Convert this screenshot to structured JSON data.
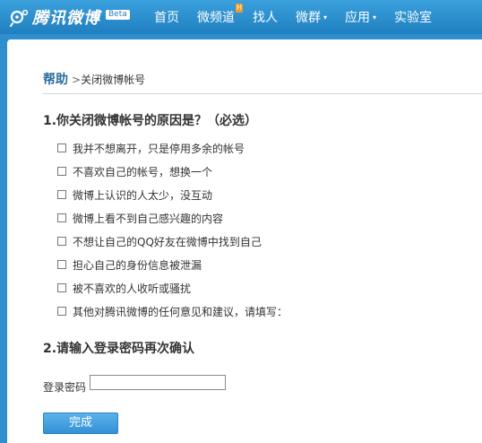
{
  "header": {
    "brand": "腾讯微博",
    "beta_badge": "Beta",
    "nav": [
      {
        "label": "首页"
      },
      {
        "label": "微频道",
        "badge": "H"
      },
      {
        "label": "找人"
      },
      {
        "label": "微群",
        "has_dropdown": true
      },
      {
        "label": "应用",
        "has_dropdown": true
      },
      {
        "label": "实验室"
      }
    ],
    "caret": "▾"
  },
  "breadcrumb": {
    "root": "帮助",
    "separator": ">",
    "current": "关闭微博帐号"
  },
  "question1": {
    "title": "1.你关闭微博帐号的原因是？（必选）",
    "options": [
      "我并不想离开，只是停用多余的帐号",
      "不喜欢自己的帐号，想换一个",
      "微博上认识的人太少，没互动",
      "微博上看不到自己感兴趣的内容",
      "不想让自己的QQ好友在微博中找到自己",
      "担心自己的身份信息被泄漏",
      "被不喜欢的人收听或骚扰",
      "其他对腾讯微博的任何意见和建议，请填写："
    ]
  },
  "question2": {
    "title": "2.请输入登录密码再次确认",
    "password_label": "登录密码",
    "password_value": ""
  },
  "submit_label": "完成",
  "colors": {
    "header_bg": "#2f8fcd",
    "breadcrumb_link": "#2b6e9a",
    "button_bg": "#3391d6",
    "hot_badge": "#f49a20"
  }
}
